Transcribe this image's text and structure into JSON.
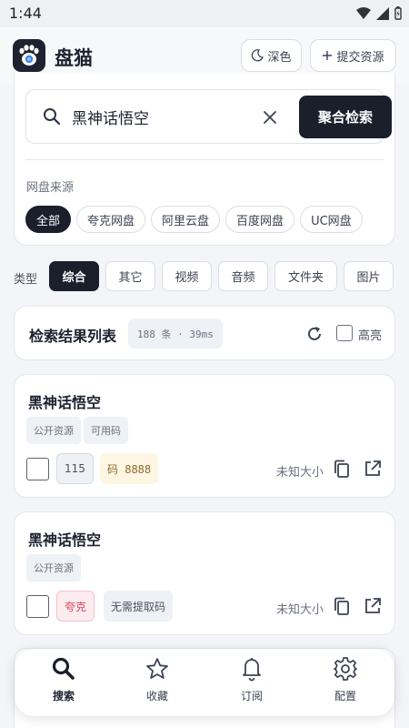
{
  "status_bar": {
    "time": "1:44"
  },
  "header": {
    "app_name": "盘猫",
    "dark_mode_label": "深色",
    "submit_label": "提交资源"
  },
  "search": {
    "query": "黑神话悟空",
    "button_label": "聚合检索"
  },
  "sources": {
    "label": "网盘来源",
    "chips": [
      "全部",
      "夸克网盘",
      "阿里云盘",
      "百度网盘",
      "UC网盘"
    ],
    "active_index": 0
  },
  "types": {
    "label": "类型",
    "chips": [
      "综合",
      "其它",
      "视频",
      "音频",
      "文件夹",
      "图片"
    ],
    "active_index": 0
  },
  "results_header": {
    "title": "检索结果列表",
    "count": "188 条 · 39ms",
    "highlight_label": "高亮"
  },
  "results": [
    {
      "title": "黑神话悟空",
      "tags": [
        "公开资源",
        "可用码"
      ],
      "platform": "115",
      "code": "码 8888",
      "size": "未知大小"
    },
    {
      "title": "黑神话悟空",
      "tags": [
        "公开资源"
      ],
      "platform": "夸克",
      "code": "无需提取码",
      "size": "未知大小"
    }
  ],
  "bottom_nav": {
    "items": [
      "搜索",
      "收藏",
      "订阅",
      "配置"
    ],
    "active_index": 0
  },
  "colors": {
    "primary_dark": "#1a1f2c",
    "page_background": "#f3f5f8",
    "code_badge_bg": "#fdf6e3",
    "quark_badge_bg": "#fdecef",
    "quark_badge_text": "#d9455f"
  }
}
